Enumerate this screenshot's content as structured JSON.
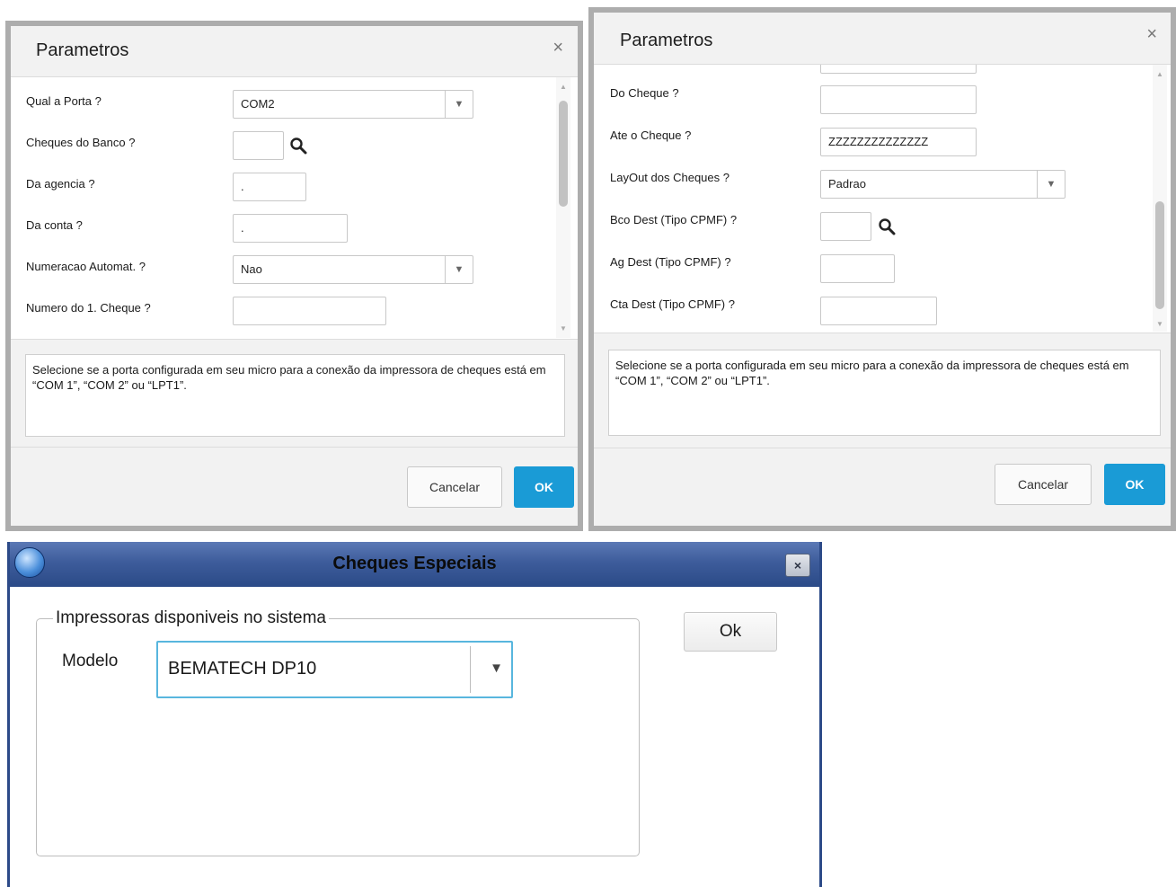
{
  "dialog1": {
    "title": "Parametros",
    "close_label": "×",
    "fields": {
      "porta": {
        "label": "Qual a Porta ?",
        "value": "COM2"
      },
      "banco": {
        "label": "Cheques do Banco ?",
        "value": ""
      },
      "agencia": {
        "label": "Da agencia ?",
        "value": "."
      },
      "conta": {
        "label": "Da conta ?",
        "value": "."
      },
      "numeracao": {
        "label": "Numeracao Automat. ?",
        "value": "Nao"
      },
      "numero": {
        "label": "Numero do 1. Cheque ?",
        "value": ""
      }
    },
    "help_text": "Selecione se a porta configurada em seu micro para a conexão da impressora de cheques está em “COM 1”, “COM 2” ou “LPT1”.",
    "cancel_label": "Cancelar",
    "ok_label": "OK"
  },
  "dialog2": {
    "title": "Parametros",
    "close_label": "×",
    "fields": {
      "do_cheque": {
        "label": "Do Cheque ?",
        "value": ""
      },
      "ate_cheque": {
        "label": "Ate o Cheque ?",
        "value": "ZZZZZZZZZZZZZZ"
      },
      "layout": {
        "label": "LayOut dos Cheques ?",
        "value": "Padrao"
      },
      "bco_dest": {
        "label": "Bco Dest (Tipo CPMF) ?",
        "value": ""
      },
      "ag_dest": {
        "label": "Ag Dest (Tipo CPMF) ?",
        "value": ""
      },
      "cta_dest": {
        "label": "Cta Dest (Tipo CPMF) ?",
        "value": ""
      }
    },
    "help_text": "Selecione se a porta configurada em seu micro para a conexão da impressora de cheques está em “COM 1”, “COM 2” ou “LPT1”.",
    "cancel_label": "Cancelar",
    "ok_label": "OK"
  },
  "dialog3": {
    "title": "Cheques Especiais",
    "close_label": "×",
    "group_label": "Impressoras disponiveis no sistema",
    "modelo_label": "Modelo",
    "modelo_value": "BEMATECH DP10",
    "ok_label": "Ok"
  },
  "colors": {
    "accent": "#1a9bd6",
    "legacy_title": "#3d5c9b",
    "focus_border": "#58b6de"
  },
  "icons": {
    "search": "search-icon",
    "dropdown": "chevron-down-icon",
    "close": "close-icon"
  }
}
